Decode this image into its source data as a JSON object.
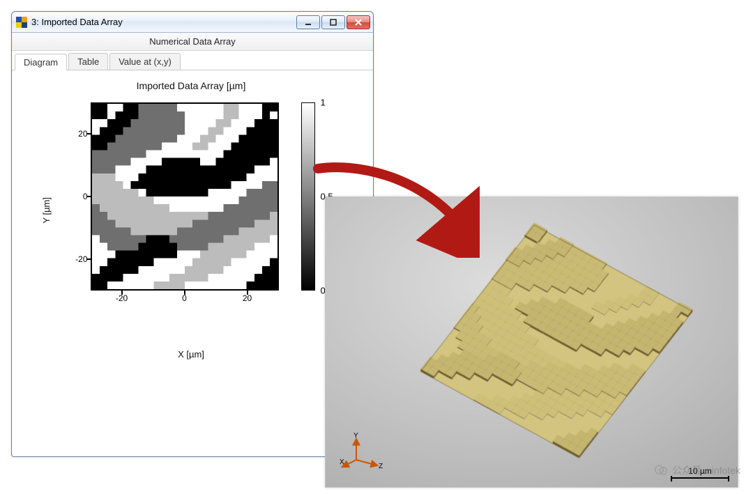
{
  "window": {
    "title": "3: Imported Data Array",
    "subheader": "Numerical Data Array"
  },
  "tabs": [
    "Diagram",
    "Table",
    "Value at (x,y)"
  ],
  "active_tab_index": 0,
  "plot": {
    "title": "Imported Data Array  [µm]",
    "x_label": "X [µm]",
    "y_label": "Y [µm]",
    "x_ticks": [
      -20,
      0,
      20
    ],
    "y_ticks": [
      -20,
      0,
      20
    ],
    "x_range": [
      -30,
      30
    ],
    "y_range": [
      -30,
      30
    ]
  },
  "colorbar": {
    "min": 0,
    "mid": 0.5,
    "max": 1
  },
  "render": {
    "scale_label": "10 µm",
    "axes": [
      "X",
      "Y",
      "Z"
    ]
  },
  "watermark": {
    "prefix": "公众号 · ",
    "name": "infotek"
  },
  "chart_data": {
    "type": "heatmap",
    "title": "Imported Data Array  [µm]",
    "xlabel": "X [µm]",
    "ylabel": "Y [µm]",
    "xlim": [
      -30,
      30
    ],
    "ylim": [
      -30,
      30
    ],
    "colorbar_range": [
      0,
      1
    ],
    "palette": {
      "0": "#ffffff",
      "1": "#bcbcbc",
      "2": "#6f6f6f",
      "3": "#000000"
    },
    "note": "24×24 grid of discrete grey levels (0=white … 3=black), visually estimated from screenshot",
    "grid": [
      [
        3,
        3,
        0,
        0,
        3,
        3,
        2,
        2,
        2,
        2,
        2,
        0,
        0,
        0,
        0,
        0,
        0,
        1,
        1,
        0,
        0,
        0,
        3,
        3
      ],
      [
        3,
        3,
        0,
        3,
        3,
        3,
        2,
        2,
        2,
        2,
        2,
        2,
        0,
        0,
        0,
        0,
        0,
        1,
        1,
        0,
        0,
        0,
        3,
        0
      ],
      [
        0,
        0,
        3,
        3,
        3,
        2,
        2,
        2,
        2,
        2,
        2,
        2,
        0,
        0,
        0,
        0,
        1,
        1,
        0,
        0,
        0,
        3,
        3,
        3
      ],
      [
        0,
        3,
        3,
        3,
        2,
        2,
        2,
        2,
        2,
        2,
        2,
        2,
        0,
        0,
        0,
        1,
        1,
        0,
        0,
        0,
        3,
        3,
        3,
        3
      ],
      [
        3,
        3,
        3,
        2,
        2,
        2,
        2,
        2,
        2,
        2,
        2,
        0,
        0,
        0,
        1,
        1,
        0,
        0,
        0,
        3,
        3,
        3,
        3,
        3
      ],
      [
        3,
        3,
        2,
        2,
        2,
        2,
        2,
        2,
        2,
        0,
        0,
        0,
        0,
        1,
        1,
        0,
        0,
        0,
        3,
        3,
        3,
        3,
        3,
        3
      ],
      [
        2,
        2,
        2,
        2,
        2,
        2,
        2,
        0,
        0,
        0,
        0,
        0,
        0,
        0,
        0,
        0,
        0,
        3,
        3,
        3,
        3,
        3,
        3,
        3
      ],
      [
        2,
        2,
        2,
        2,
        2,
        0,
        0,
        0,
        0,
        3,
        3,
        3,
        3,
        3,
        0,
        0,
        3,
        3,
        3,
        3,
        3,
        3,
        3,
        0
      ],
      [
        2,
        2,
        2,
        0,
        0,
        0,
        0,
        3,
        3,
        3,
        3,
        3,
        3,
        3,
        3,
        3,
        3,
        3,
        3,
        3,
        3,
        0,
        0,
        0
      ],
      [
        1,
        1,
        1,
        0,
        0,
        0,
        3,
        3,
        3,
        3,
        3,
        3,
        3,
        3,
        3,
        3,
        3,
        3,
        3,
        3,
        0,
        0,
        0,
        0
      ],
      [
        1,
        1,
        1,
        1,
        0,
        3,
        3,
        3,
        3,
        3,
        3,
        3,
        3,
        3,
        3,
        3,
        3,
        3,
        0,
        0,
        0,
        0,
        2,
        2
      ],
      [
        1,
        1,
        1,
        1,
        1,
        1,
        0,
        3,
        3,
        3,
        3,
        3,
        3,
        3,
        3,
        0,
        0,
        0,
        0,
        0,
        2,
        2,
        2,
        2
      ],
      [
        1,
        1,
        1,
        1,
        1,
        1,
        1,
        1,
        0,
        0,
        0,
        0,
        0,
        0,
        0,
        0,
        0,
        0,
        0,
        2,
        2,
        2,
        2,
        2
      ],
      [
        2,
        1,
        1,
        1,
        1,
        1,
        1,
        1,
        1,
        1,
        0,
        0,
        0,
        0,
        0,
        0,
        0,
        2,
        2,
        2,
        2,
        2,
        2,
        2
      ],
      [
        2,
        2,
        1,
        1,
        1,
        1,
        1,
        1,
        1,
        1,
        1,
        1,
        1,
        1,
        1,
        2,
        2,
        2,
        2,
        2,
        2,
        2,
        2,
        1
      ],
      [
        2,
        2,
        2,
        1,
        1,
        1,
        1,
        1,
        1,
        1,
        1,
        1,
        1,
        2,
        2,
        2,
        2,
        2,
        2,
        2,
        2,
        1,
        1,
        1
      ],
      [
        2,
        2,
        2,
        2,
        2,
        1,
        1,
        1,
        1,
        1,
        1,
        2,
        2,
        2,
        2,
        2,
        2,
        2,
        2,
        1,
        1,
        1,
        1,
        1
      ],
      [
        0,
        2,
        2,
        2,
        2,
        2,
        2,
        3,
        3,
        3,
        2,
        2,
        2,
        2,
        2,
        2,
        2,
        1,
        1,
        1,
        1,
        1,
        1,
        0
      ],
      [
        0,
        0,
        2,
        2,
        2,
        2,
        3,
        3,
        3,
        3,
        3,
        2,
        2,
        2,
        2,
        1,
        1,
        1,
        1,
        1,
        1,
        0,
        0,
        0
      ],
      [
        0,
        0,
        0,
        3,
        3,
        3,
        3,
        3,
        3,
        3,
        3,
        0,
        0,
        0,
        1,
        1,
        1,
        1,
        1,
        1,
        0,
        0,
        0,
        0
      ],
      [
        0,
        0,
        3,
        3,
        3,
        3,
        3,
        3,
        0,
        0,
        0,
        0,
        0,
        1,
        1,
        1,
        1,
        1,
        0,
        0,
        0,
        0,
        0,
        3
      ],
      [
        0,
        3,
        3,
        3,
        3,
        3,
        0,
        0,
        0,
        0,
        0,
        0,
        1,
        1,
        1,
        1,
        1,
        0,
        0,
        0,
        0,
        0,
        3,
        3
      ],
      [
        3,
        3,
        3,
        3,
        0,
        0,
        0,
        0,
        0,
        0,
        1,
        1,
        1,
        1,
        1,
        0,
        0,
        0,
        0,
        0,
        0,
        3,
        3,
        3
      ],
      [
        3,
        3,
        0,
        0,
        0,
        0,
        0,
        0,
        1,
        1,
        1,
        1,
        0,
        0,
        0,
        0,
        0,
        0,
        0,
        0,
        3,
        3,
        3,
        3
      ]
    ]
  }
}
